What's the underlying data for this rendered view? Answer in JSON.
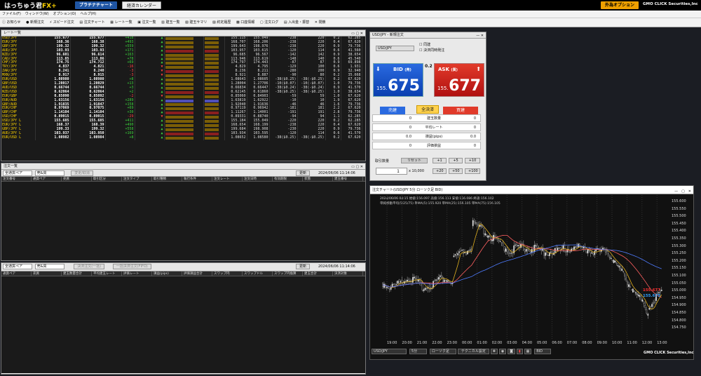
{
  "top": {
    "logo": "はっちゅう君",
    "logo_fx": "FX+",
    "platinum_chart": "プラチナチャート",
    "calendar": "経済カレンダー",
    "fx_option": "外為オプション",
    "company": "GMO CLICK Securities,Inc"
  },
  "menu": [
    "ファイル(F)",
    "ウィンドウ(W)",
    "オプション(O)",
    "ヘルプ(H)"
  ],
  "toolbar": [
    "お知らせ",
    "新規注文",
    "スピード注文",
    "注文チャート",
    "レート一覧",
    "注文一覧",
    "建玉一覧",
    "建玉サマリ",
    "約定履歴",
    "口座情報",
    "注文ログ",
    "入出金・振替",
    "閉鎖"
  ],
  "rate_window": {
    "title": "レート一覧",
    "rows": [
      {
        "pair": "USD/JPY",
        "bid": "155.677",
        "ask": "155.677",
        "chg": "+418",
        "hi": "155.115",
        "lo": "155.049",
        "d": "-238",
        "s": "220",
        "sp": "0.2",
        "last": "62.285",
        "up": true
      },
      {
        "pair": "EUR/JPY",
        "bid": "168.36",
        "ask": "168.38",
        "chg": "+493",
        "hi": "168.707",
        "lo": "168.206",
        "d": "-238",
        "s": "220",
        "sp": "0.4",
        "last": "67.620",
        "up": true
      },
      {
        "pair": "GBP/JPY",
        "bid": "199.32",
        "ask": "199.32",
        "chg": "+559",
        "hi": "199.643",
        "lo": "198.976",
        "d": "-238",
        "s": "220",
        "sp": "0.9",
        "last": "79.736",
        "up": true
      },
      {
        "pair": "AUD/JPY",
        "bid": "103.93",
        "ask": "103.93",
        "chg": "+171",
        "hi": "103.957",
        "lo": "103.615",
        "d": "-120",
        "s": "114",
        "sp": "0.6",
        "last": "41.560",
        "up": true
      },
      {
        "pair": "NZD/JPY",
        "bid": "96.601",
        "ask": "96.614",
        "chg": "+163",
        "hi": "96.685",
        "lo": "96.567",
        "d": "-142",
        "s": "142",
        "sp": "0.9",
        "last": "38.654",
        "up": true
      },
      {
        "pair": "CAD/JPY",
        "bid": "113.85",
        "ask": "113.86",
        "chg": "+78",
        "hi": "113.946",
        "lo": "113.619",
        "d": "-148",
        "s": "140",
        "sp": "0.6",
        "last": "45.540",
        "up": true
      },
      {
        "pair": "CHF/JPY",
        "bid": "174.75",
        "ask": "174.712",
        "chg": "+69",
        "hi": "174.797",
        "lo": "174.443",
        "d": "-87",
        "s": "87",
        "sp": "0.9",
        "last": "69.898",
        "up": true
      },
      {
        "pair": "TRY/JPY",
        "bid": "4.837",
        "ask": "4.821",
        "chg": "-16",
        "hi": "4.829",
        "lo": "4.795",
        "d": "-129",
        "s": "100",
        "sp": "0.6",
        "last": "1.931",
        "up": false
      },
      {
        "pair": "ZAR/JPY",
        "bid": "8.241",
        "ask": "8.240",
        "chg": "-3",
        "hi": "8.236",
        "lo": "8.211",
        "d": "-280",
        "s": "200",
        "sp": "0.9",
        "last": "32.940",
        "up": false
      },
      {
        "pair": "MXN/JPY",
        "bid": "8.917",
        "ask": "8.915",
        "chg": "-3",
        "hi": "8.921",
        "lo": "8.887",
        "d": "-90",
        "s": "80",
        "sp": "0.2",
        "last": "35.668",
        "up": false
      },
      {
        "pair": "EUR/USD",
        "bid": "1.08980",
        "ask": "1.08980",
        "chg": "+8",
        "hi": "1.08643",
        "lo": "1.08605",
        "d": "-38($0.25)",
        "s": "-38(-$0.25)",
        "sp": "0.2",
        "last": "67.620",
        "up": true
      },
      {
        "pair": "GBP/USD",
        "bid": "1.28017",
        "ask": "1.28029",
        "chg": "+13",
        "hi": "1.28004",
        "lo": "1.27706",
        "d": "-10($0.07)",
        "s": "-10(-$0.07)",
        "sp": "1.0",
        "last": "79.736",
        "up": true
      },
      {
        "pair": "AUD/USD",
        "bid": "0.66744",
        "ask": "0.66744",
        "chg": "+3",
        "hi": "0.66834",
        "lo": "0.66447",
        "d": "-38($0.24)",
        "s": "-38(-$0.24)",
        "sp": "0.9",
        "last": "41.570",
        "up": true
      },
      {
        "pair": "NZD/USD",
        "bid": "0.62064",
        "ask": "0.62064",
        "chg": "+2",
        "hi": "0.62145",
        "lo": "0.61860",
        "d": "-38($0.25)",
        "s": "-38(-$0.25)",
        "sp": "1.0",
        "last": "38.634",
        "up": true
      },
      {
        "pair": "EUR/GBP",
        "bid": "0.85090",
        "ask": "0.85092",
        "chg": "-2",
        "hi": "0.85060",
        "lo": "0.84903",
        "d": "-59",
        "s": "59",
        "sp": "1.0",
        "last": "67.620",
        "up": false
      },
      {
        "pair": "EUR/AUD",
        "bid": "1.63156",
        "ask": "1.63156",
        "chg": "+289",
        "hi": "1.63819",
        "lo": "1.62922",
        "d": "-10",
        "s": "10",
        "sp": "1.9",
        "last": "67.620",
        "up": true
      },
      {
        "pair": "GBP/AUD",
        "bid": "1.91835",
        "ask": "1.91847",
        "chg": "+158",
        "hi": "1.92040",
        "lo": "1.91636",
        "d": "-46",
        "s": "46",
        "sp": "1.6",
        "last": "79.736",
        "up": true
      },
      {
        "pair": "EUR/CHF",
        "bid": "0.97069",
        "ask": "0.97075",
        "chg": "+69",
        "hi": "0.97119",
        "lo": "0.96942",
        "d": "-181",
        "s": "181",
        "sp": "2.2",
        "last": "67.620",
        "up": true
      },
      {
        "pair": "GBP/CHF",
        "bid": "1.14104",
        "ask": "1.14104",
        "chg": "+30",
        "hi": "1.11267",
        "lo": "1.14001",
        "d": "-191",
        "s": "191",
        "sp": "2.8",
        "last": "79.736",
        "up": true
      },
      {
        "pair": "USD/CHF",
        "bid": "0.89015",
        "ask": "0.89015",
        "chg": "-29",
        "hi": "0.89331",
        "lo": "0.88740",
        "d": "-94",
        "s": "94",
        "sp": "1.1",
        "last": "62.285",
        "up": false
      },
      {
        "pair": "USD/JPY L",
        "bid": "155.685",
        "ask": "155.685",
        "chg": "+411",
        "hi": "155.184",
        "lo": "155.049",
        "d": "-220",
        "s": "220",
        "sp": "0.2",
        "last": "62.285",
        "up": true
      },
      {
        "pair": "EUR/JPY L",
        "bid": "168.37",
        "ask": "168.39",
        "chg": "+490",
        "hi": "168.654",
        "lo": "168.199",
        "d": "-238",
        "s": "220",
        "sp": "0.4",
        "last": "67.620",
        "up": true
      },
      {
        "pair": "GBP/JPY L",
        "bid": "199.33",
        "ask": "199.32",
        "chg": "+558",
        "hi": "199.684",
        "lo": "198.908",
        "d": "-230",
        "s": "220",
        "sp": "0.9",
        "last": "79.736",
        "up": true
      },
      {
        "pair": "AUD/JPY L",
        "bid": "103.937",
        "ask": "103.950",
        "chg": "+169",
        "hi": "103.934",
        "lo": "103.595",
        "d": "-120",
        "s": "114",
        "sp": "0.6",
        "last": "41.570",
        "up": true
      },
      {
        "pair": "EUR/USD L",
        "bid": "1.08982",
        "ask": "1.08984",
        "chg": "+8",
        "hi": "1.08652",
        "lo": "1.08580",
        "d": "-38($0.25)",
        "s": "-38(-$0.25)",
        "sp": "0.2",
        "last": "67.620",
        "up": true
      }
    ]
  },
  "order_list": {
    "title": "注文一覧",
    "pair_sel": "全通貨ペア",
    "side_sel": "売&買",
    "change_btn": "変更/取消",
    "refresh": "更新",
    "datetime": "2024/06/06 11:14:06",
    "headers": [
      "注文番号",
      "通貨ペア",
      "売買",
      "取引区分",
      "注文タイプ",
      "取引種類",
      "執行条件",
      "注文レート",
      "注文日時",
      "有効期限",
      "状態",
      "建玉番号"
    ]
  },
  "position_list": {
    "pair_sel": "全通貨ペア",
    "side_sel": "売&買",
    "bulk_btn": "決済注文(一括)",
    "bulk_btn2": "一括決済注文(FIFO)",
    "refresh": "更新",
    "datetime": "2024/06/06 11:14:06",
    "headers": [
      "通貨ペア",
      "売買",
      "建玉数量合計",
      "平均建玉レート",
      "評価レート",
      "損益(pips)",
      "評価損益合計",
      "スワップ円",
      "スワップドル",
      "スワップ円換算",
      "建玉合計",
      "決済対象"
    ]
  },
  "order": {
    "title": "USD/JPY - 新規注文",
    "pair": "USD/JPY",
    "check1": "同建",
    "check2": "決済同時発注",
    "bid_label": "BID",
    "bid_unit": "(売)",
    "bid_pre": "155.",
    "bid_main": "675",
    "ask_label": "ASK",
    "ask_unit": "(買)",
    "ask_pre": "155.",
    "ask_main": "677",
    "spread": "0.2",
    "sell_btn": "売建",
    "all_close": "全決済",
    "buy_btn": "買建",
    "info": [
      {
        "l": "0",
        "k": "建玉数量",
        "r": "0"
      },
      {
        "l": "0",
        "k": "平均レート",
        "r": "0"
      },
      {
        "l": "0.0",
        "k": "損益(pips)",
        "r": "0.0"
      },
      {
        "l": "0",
        "k": "評価損益",
        "r": "0"
      }
    ],
    "qty_label": "取引数量",
    "reset": "リセット",
    "qty": "1",
    "qty_unit": "x 10,000",
    "steps": [
      "+1",
      "+5",
      "+10",
      "+20",
      "+50",
      "+100"
    ]
  },
  "chart": {
    "title": "注文チャート(USD/JPY 5分 ローソク足 BID)",
    "info1": "2024/06/06 04:15 始値:156.097 高値:156.113 安値:156.086 終値:156.102",
    "info2": "単純移動平均(5/25/75) 単MA(5):155.920 単MA(25):156.105 単MA(75):156.105",
    "yticks": [
      "155.600",
      "155.550",
      "155.500",
      "155.450",
      "155.400",
      "155.350",
      "155.300",
      "155.250",
      "155.200",
      "155.150",
      "155.100",
      "155.050",
      "155.000",
      "154.950",
      "154.900",
      "154.850",
      "154.800",
      "154.750"
    ],
    "xticks": [
      "19:00",
      "20:00",
      "21:00",
      "22:00",
      "23:00",
      "00:00",
      "01:00",
      "02:00",
      "03:00",
      "04:00",
      "05:00",
      "06:00",
      "07:00",
      "08:00",
      "09:00",
      "10:00",
      "11:00",
      "12:00",
      "13:00"
    ],
    "ask_price": "155.677",
    "bid_price": "155.675",
    "pair_sel": "USD/JPY",
    "tf_sel": "5分",
    "type_sel": "ローソク足",
    "tech_btn": "テクニカル設定",
    "side_sel": "BID",
    "footer": "GMO CLICK Securities,Inc"
  }
}
